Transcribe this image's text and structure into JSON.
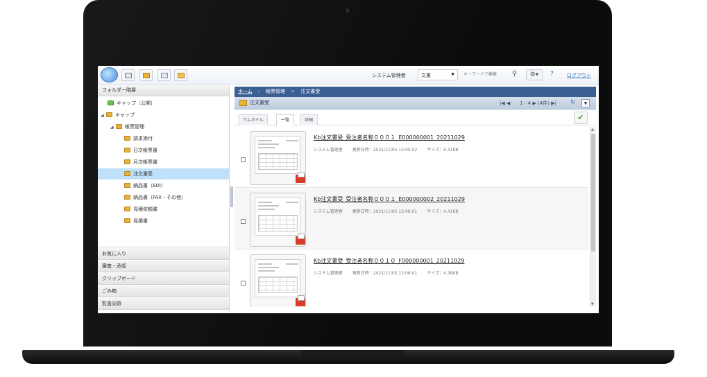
{
  "toolbar": {
    "user_label": "システム管理者",
    "select_value": "文書",
    "keyword_placeholder": "キーワードで検索",
    "help_label": "?",
    "logout_label": "ログアウト"
  },
  "left_panel": {
    "header": "フォルダー階層",
    "tree": [
      {
        "label": "キャップ（公開）",
        "indent": 0,
        "twisty": "",
        "color": "green"
      },
      {
        "label": "キャップ",
        "indent": 0,
        "twisty": "◢",
        "color": "yellow"
      },
      {
        "label": "帳票管理",
        "indent": 1,
        "twisty": "◢",
        "color": "yellow"
      },
      {
        "label": "請求添付",
        "indent": 2,
        "twisty": "",
        "color": "yellow"
      },
      {
        "label": "日次帳票書",
        "indent": 2,
        "twisty": "",
        "color": "yellow"
      },
      {
        "label": "月次帳票書",
        "indent": 2,
        "twisty": "",
        "color": "yellow"
      },
      {
        "label": "注文書受",
        "indent": 2,
        "twisty": "",
        "color": "yellow",
        "selected": true
      },
      {
        "label": "納品書（EDI）",
        "indent": 2,
        "twisty": "",
        "color": "yellow"
      },
      {
        "label": "納品書（FAX・その他）",
        "indent": 2,
        "twisty": "",
        "color": "yellow"
      },
      {
        "label": "見積依頼書",
        "indent": 2,
        "twisty": "",
        "color": "yellow"
      },
      {
        "label": "見積書",
        "indent": 2,
        "twisty": "",
        "color": "yellow"
      }
    ],
    "categories": [
      "お気に入り",
      "審査・承認",
      "クリップボード",
      "ごみ箱",
      "監査証跡"
    ]
  },
  "right_panel": {
    "breadcrumb": [
      "ホーム",
      "帳票管理",
      "注文書受"
    ],
    "breadcrumb_sep": ">",
    "folder_title": "注文書受",
    "pager": "|◀ ◀　　1 - 4 ▶ (4件) ▶|",
    "refresh_label": "↻",
    "menu_label": "▼",
    "tabs": [
      "サムネイル",
      "一覧",
      "詳細"
    ],
    "active_tab": 1,
    "items": [
      {
        "title": "Kb注文書受_受注者名称０００１_E000000001_20211029",
        "user": "システム管理者",
        "updated": "更新日時：2021/11/05 13:05:52",
        "size": "サイズ：6.31KB"
      },
      {
        "title": "Kb注文書受_受注者名称０００１_E000000002_20211029",
        "user": "システム管理者",
        "updated": "更新日時：2021/11/05 13:06:01",
        "size": "サイズ：4.41KB"
      },
      {
        "title": "Kb注文書受_受注者名称００１０_F000000001_20211029",
        "user": "システム管理者",
        "updated": "更新日時：2021/11/05 13:06:01",
        "size": "サイズ：4.38KB"
      }
    ]
  },
  "colors": {
    "breadcrumb_bg": "#3a5f93",
    "selected_row": "#bfe0fb",
    "link": "#2a6ebd",
    "pdf_red": "#d93b2b"
  }
}
